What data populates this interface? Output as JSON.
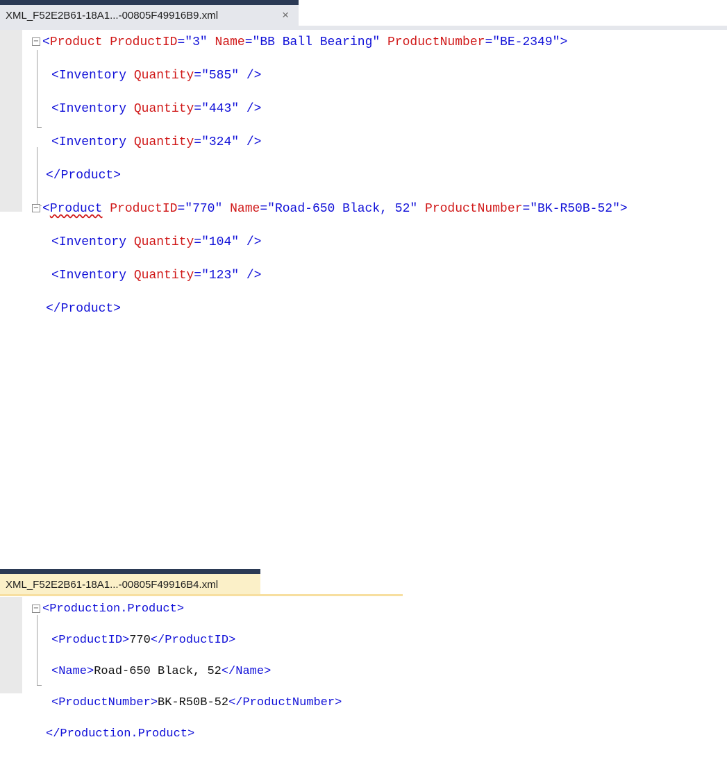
{
  "colors": {
    "delimiter": "#1010d8",
    "element": "#1010d8",
    "attribute": "#d01818",
    "value": "#1010d8",
    "text": "#111111"
  },
  "panel1": {
    "tab_title": "XML_F52E2B61-18A1...-00805F49916B9.xml",
    "close_icon": "×",
    "products": [
      {
        "element": "Product",
        "attrs": [
          {
            "name": "ProductID",
            "value": "3"
          },
          {
            "name": "Name",
            "value": "BB Ball Bearing"
          },
          {
            "name": "ProductNumber",
            "value": "BE-2349"
          }
        ],
        "children": [
          {
            "element": "Inventory",
            "attr": "Quantity",
            "value": "585"
          },
          {
            "element": "Inventory",
            "attr": "Quantity",
            "value": "443"
          },
          {
            "element": "Inventory",
            "attr": "Quantity",
            "value": "324"
          }
        ]
      },
      {
        "element": "Product",
        "attrs": [
          {
            "name": "ProductID",
            "value": "770"
          },
          {
            "name": "Name",
            "value": "Road-650 Black, 52"
          },
          {
            "name": "ProductNumber",
            "value": "BK-R50B-52"
          }
        ],
        "children": [
          {
            "element": "Inventory",
            "attr": "Quantity",
            "value": "104"
          },
          {
            "element": "Inventory",
            "attr": "Quantity",
            "value": "123"
          }
        ]
      }
    ]
  },
  "panel2": {
    "tab_title": "XML_F52E2B61-18A1...-00805F49916B4.xml",
    "root_element": "Production.Product",
    "fields": [
      {
        "element": "ProductID",
        "value": "770"
      },
      {
        "element": "Name",
        "value": "Road-650 Black, 52"
      },
      {
        "element": "ProductNumber",
        "value": "BK-R50B-52"
      }
    ]
  }
}
